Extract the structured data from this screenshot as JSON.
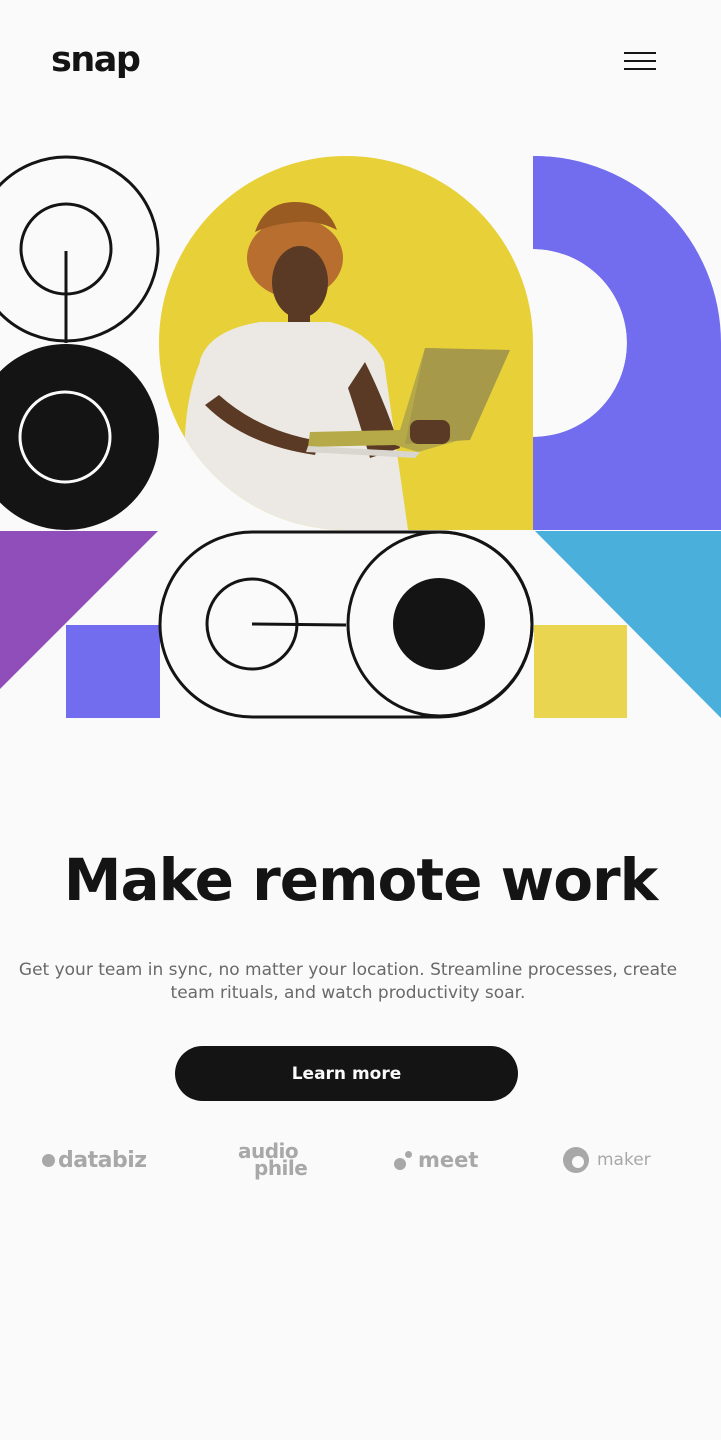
{
  "header": {
    "logo": "snap",
    "menu_icon": "hamburger-icon"
  },
  "hero": {
    "image_alt": "Man in white t-shirt typing on a laptop against yellow background",
    "colors": {
      "purple": "#726CEE",
      "violet": "#904EBB",
      "blue": "#4BAFDC",
      "yellow": "#EAD550",
      "yellow_bg": "#E5CC2F",
      "black": "#141414"
    }
  },
  "content": {
    "headline": "Make remote work",
    "subtext": "Get your team in sync, no matter your location. Streamline processes, create team rituals, and watch productivity soar.",
    "cta_label": "Learn more"
  },
  "clients": {
    "databiz": "databiz",
    "audiophile_1": "audio",
    "audiophile_2": "phile",
    "meet": "meet",
    "maker": "maker"
  }
}
